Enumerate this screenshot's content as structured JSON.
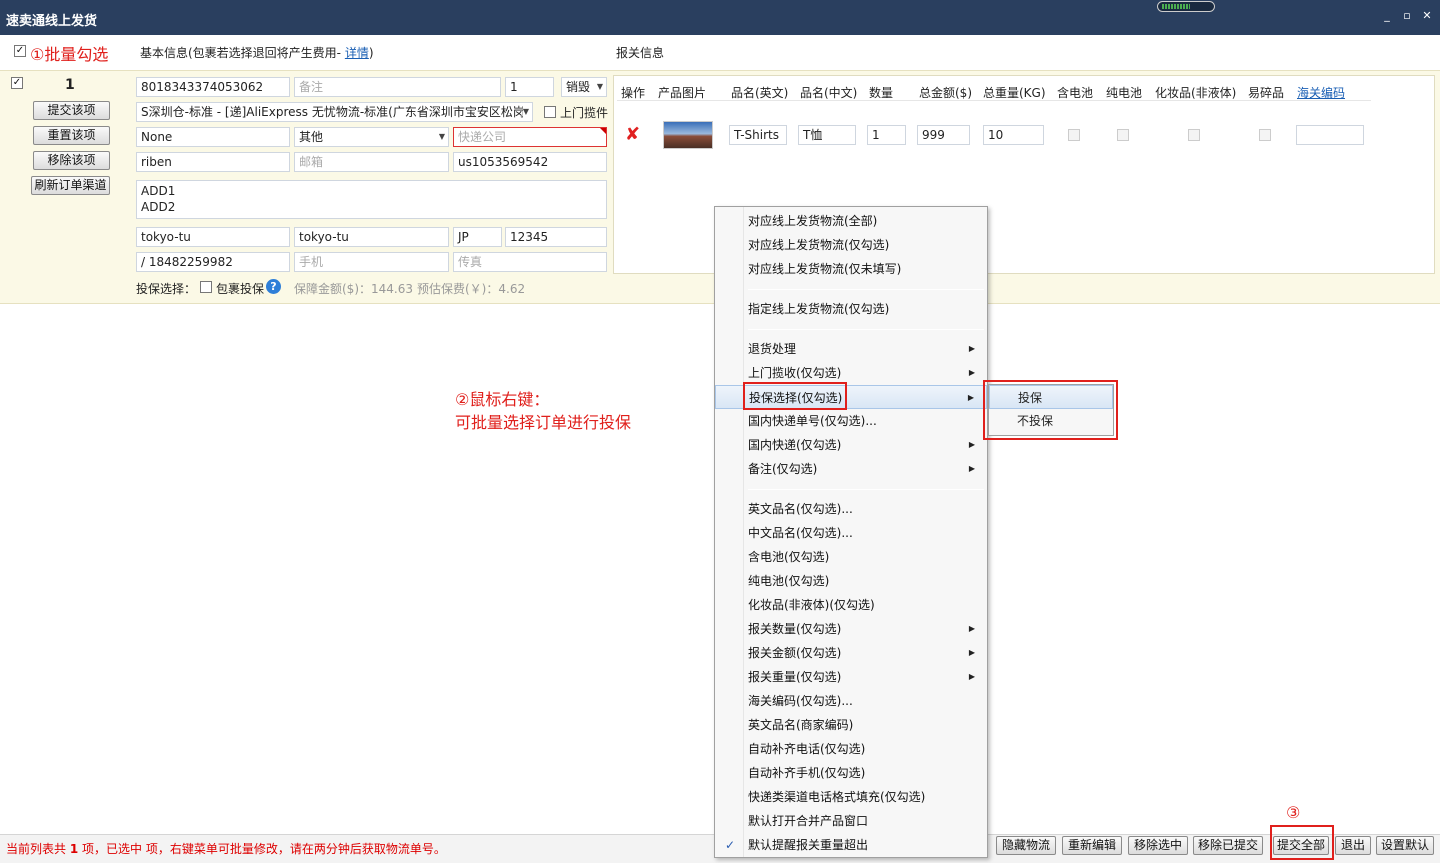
{
  "window": {
    "title": "速卖通线上发货",
    "meter_fraction": 0.55,
    "btn_minimize": "_",
    "btn_restore": "▫",
    "btn_close": "✕"
  },
  "toolbar": {
    "batch_check_annot": "①批量勾选",
    "basic_info": "基本信息(包裹若选择退回将产生费用-",
    "detail_link": "详情",
    "basic_info_end": ")",
    "customs_info": "报关信息"
  },
  "order": {
    "index": "1",
    "actions": [
      "提交该项",
      "重置该项",
      "移除该项",
      "刷新订单渠道"
    ],
    "tracking_no": "8018343374053062",
    "remark_placeholder": "备注",
    "qty": "1",
    "disposal": "销毁",
    "channel": "S深圳仓-标准 - [递]AliExpress 无忧物流-标准(广东省深圳市宝安区松岗",
    "pickup_label": "上门揽件",
    "none_value": "None",
    "other_value": "其他",
    "express_placeholder": "快递公司",
    "name": "riben",
    "email_placeholder": "邮箱",
    "order_code": "us1053569542",
    "address_lines": [
      "ADD1",
      "ADD2"
    ],
    "city": "tokyo-tu",
    "state": "tokyo-tu",
    "country": "JP",
    "zip": "12345",
    "phone": "/ 18482259982",
    "mobile_placeholder": "手机",
    "fax_placeholder": "传真",
    "insure_label": "投保选择：",
    "insure_pkg": "包裹投保",
    "help_icon": "?",
    "guarantee": "保障金额($)：144.63",
    "est_premium": "预估保费(￥)：4.62"
  },
  "customs": {
    "headers": [
      "操作",
      "产品图片",
      "品名(英文)",
      "品名(中文)",
      "数量",
      "总金额($)",
      "总重量(KG)",
      "含电池",
      "纯电池",
      "化妆品(非液体)",
      "易碎品",
      "海关编码"
    ],
    "row": {
      "name_en": "T-Shirts",
      "name_cn": "T恤",
      "qty": "1",
      "amount": "999",
      "weight": "10"
    }
  },
  "context_menu": {
    "items": [
      {
        "label": "对应线上发货物流(全部)",
        "arrow": false
      },
      {
        "label": "对应线上发货物流(仅勾选)",
        "arrow": false
      },
      {
        "label": "对应线上发货物流(仅未填写)",
        "arrow": false
      },
      {
        "label": "指定线上发货物流(仅勾选)",
        "arrow": false
      },
      {
        "label": "退货处理",
        "arrow": true
      },
      {
        "label": "上门揽收(仅勾选)",
        "arrow": true
      },
      {
        "label": "投保选择(仅勾选)",
        "arrow": true
      },
      {
        "label": "国内快递单号(仅勾选)...",
        "arrow": false
      },
      {
        "label": "国内快递(仅勾选)",
        "arrow": true
      },
      {
        "label": "备注(仅勾选)",
        "arrow": true
      },
      {
        "label": "英文品名(仅勾选)...",
        "arrow": false
      },
      {
        "label": "中文品名(仅勾选)...",
        "arrow": false
      },
      {
        "label": "含电池(仅勾选)",
        "arrow": false
      },
      {
        "label": "纯电池(仅勾选)",
        "arrow": false
      },
      {
        "label": "化妆品(非液体)(仅勾选)",
        "arrow": false
      },
      {
        "label": "报关数量(仅勾选)",
        "arrow": true
      },
      {
        "label": "报关金额(仅勾选)",
        "arrow": true
      },
      {
        "label": "报关重量(仅勾选)",
        "arrow": true
      },
      {
        "label": "海关编码(仅勾选)...",
        "arrow": false
      },
      {
        "label": "英文品名(商家编码)",
        "arrow": false
      },
      {
        "label": "自动补齐电话(仅勾选)",
        "arrow": false
      },
      {
        "label": "自动补齐手机(仅勾选)",
        "arrow": false
      },
      {
        "label": "快递类渠道电话格式填充(仅勾选)",
        "arrow": false
      },
      {
        "label": "默认打开合并产品窗口",
        "arrow": false
      },
      {
        "label": "默认提醒报关重量超出",
        "arrow": false,
        "checked": true
      }
    ],
    "arrow_glyph": "▶",
    "check_glyph": "✓"
  },
  "submenu": {
    "items": [
      "投保",
      "不投保"
    ]
  },
  "annotations": {
    "step2_line1": "②鼠标右键：",
    "step2_line2": "可批量选择订单进行投保",
    "step3": "③"
  },
  "status": {
    "prefix": "当前列表共 ",
    "count": "1",
    "suffix": " 项，已选中  项，右键菜单可批量修改，请在两分钟后获取物流单号。"
  },
  "bottom_buttons": [
    "隐藏物流",
    "重新编辑",
    "移除选中",
    "移除已提交",
    "提交全部",
    "退出",
    "设置默认"
  ],
  "colors": {
    "titlebar": "#2a3f5f",
    "annotation_red": "#e0201c",
    "order_bg": "#fbf9e6"
  }
}
